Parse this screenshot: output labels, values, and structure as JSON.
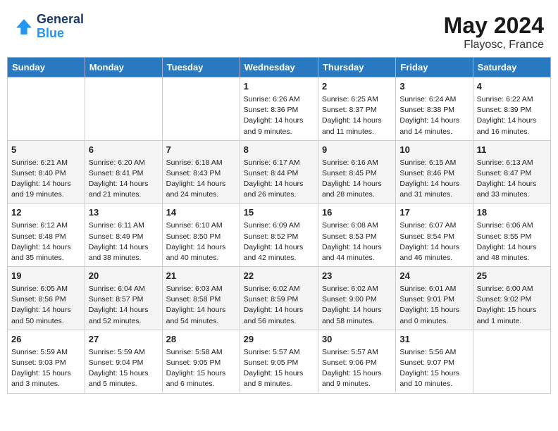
{
  "header": {
    "logo_line1": "General",
    "logo_line2": "Blue",
    "month_year": "May 2024",
    "location": "Flayosc, France"
  },
  "days_of_week": [
    "Sunday",
    "Monday",
    "Tuesday",
    "Wednesday",
    "Thursday",
    "Friday",
    "Saturday"
  ],
  "weeks": [
    [
      {
        "day": "",
        "info": ""
      },
      {
        "day": "",
        "info": ""
      },
      {
        "day": "",
        "info": ""
      },
      {
        "day": "1",
        "info": "Sunrise: 6:26 AM\nSunset: 8:36 PM\nDaylight: 14 hours\nand 9 minutes."
      },
      {
        "day": "2",
        "info": "Sunrise: 6:25 AM\nSunset: 8:37 PM\nDaylight: 14 hours\nand 11 minutes."
      },
      {
        "day": "3",
        "info": "Sunrise: 6:24 AM\nSunset: 8:38 PM\nDaylight: 14 hours\nand 14 minutes."
      },
      {
        "day": "4",
        "info": "Sunrise: 6:22 AM\nSunset: 8:39 PM\nDaylight: 14 hours\nand 16 minutes."
      }
    ],
    [
      {
        "day": "5",
        "info": "Sunrise: 6:21 AM\nSunset: 8:40 PM\nDaylight: 14 hours\nand 19 minutes."
      },
      {
        "day": "6",
        "info": "Sunrise: 6:20 AM\nSunset: 8:41 PM\nDaylight: 14 hours\nand 21 minutes."
      },
      {
        "day": "7",
        "info": "Sunrise: 6:18 AM\nSunset: 8:43 PM\nDaylight: 14 hours\nand 24 minutes."
      },
      {
        "day": "8",
        "info": "Sunrise: 6:17 AM\nSunset: 8:44 PM\nDaylight: 14 hours\nand 26 minutes."
      },
      {
        "day": "9",
        "info": "Sunrise: 6:16 AM\nSunset: 8:45 PM\nDaylight: 14 hours\nand 28 minutes."
      },
      {
        "day": "10",
        "info": "Sunrise: 6:15 AM\nSunset: 8:46 PM\nDaylight: 14 hours\nand 31 minutes."
      },
      {
        "day": "11",
        "info": "Sunrise: 6:13 AM\nSunset: 8:47 PM\nDaylight: 14 hours\nand 33 minutes."
      }
    ],
    [
      {
        "day": "12",
        "info": "Sunrise: 6:12 AM\nSunset: 8:48 PM\nDaylight: 14 hours\nand 35 minutes."
      },
      {
        "day": "13",
        "info": "Sunrise: 6:11 AM\nSunset: 8:49 PM\nDaylight: 14 hours\nand 38 minutes."
      },
      {
        "day": "14",
        "info": "Sunrise: 6:10 AM\nSunset: 8:50 PM\nDaylight: 14 hours\nand 40 minutes."
      },
      {
        "day": "15",
        "info": "Sunrise: 6:09 AM\nSunset: 8:52 PM\nDaylight: 14 hours\nand 42 minutes."
      },
      {
        "day": "16",
        "info": "Sunrise: 6:08 AM\nSunset: 8:53 PM\nDaylight: 14 hours\nand 44 minutes."
      },
      {
        "day": "17",
        "info": "Sunrise: 6:07 AM\nSunset: 8:54 PM\nDaylight: 14 hours\nand 46 minutes."
      },
      {
        "day": "18",
        "info": "Sunrise: 6:06 AM\nSunset: 8:55 PM\nDaylight: 14 hours\nand 48 minutes."
      }
    ],
    [
      {
        "day": "19",
        "info": "Sunrise: 6:05 AM\nSunset: 8:56 PM\nDaylight: 14 hours\nand 50 minutes."
      },
      {
        "day": "20",
        "info": "Sunrise: 6:04 AM\nSunset: 8:57 PM\nDaylight: 14 hours\nand 52 minutes."
      },
      {
        "day": "21",
        "info": "Sunrise: 6:03 AM\nSunset: 8:58 PM\nDaylight: 14 hours\nand 54 minutes."
      },
      {
        "day": "22",
        "info": "Sunrise: 6:02 AM\nSunset: 8:59 PM\nDaylight: 14 hours\nand 56 minutes."
      },
      {
        "day": "23",
        "info": "Sunrise: 6:02 AM\nSunset: 9:00 PM\nDaylight: 14 hours\nand 58 minutes."
      },
      {
        "day": "24",
        "info": "Sunrise: 6:01 AM\nSunset: 9:01 PM\nDaylight: 15 hours\nand 0 minutes."
      },
      {
        "day": "25",
        "info": "Sunrise: 6:00 AM\nSunset: 9:02 PM\nDaylight: 15 hours\nand 1 minute."
      }
    ],
    [
      {
        "day": "26",
        "info": "Sunrise: 5:59 AM\nSunset: 9:03 PM\nDaylight: 15 hours\nand 3 minutes."
      },
      {
        "day": "27",
        "info": "Sunrise: 5:59 AM\nSunset: 9:04 PM\nDaylight: 15 hours\nand 5 minutes."
      },
      {
        "day": "28",
        "info": "Sunrise: 5:58 AM\nSunset: 9:05 PM\nDaylight: 15 hours\nand 6 minutes."
      },
      {
        "day": "29",
        "info": "Sunrise: 5:57 AM\nSunset: 9:05 PM\nDaylight: 15 hours\nand 8 minutes."
      },
      {
        "day": "30",
        "info": "Sunrise: 5:57 AM\nSunset: 9:06 PM\nDaylight: 15 hours\nand 9 minutes."
      },
      {
        "day": "31",
        "info": "Sunrise: 5:56 AM\nSunset: 9:07 PM\nDaylight: 15 hours\nand 10 minutes."
      },
      {
        "day": "",
        "info": ""
      }
    ]
  ]
}
